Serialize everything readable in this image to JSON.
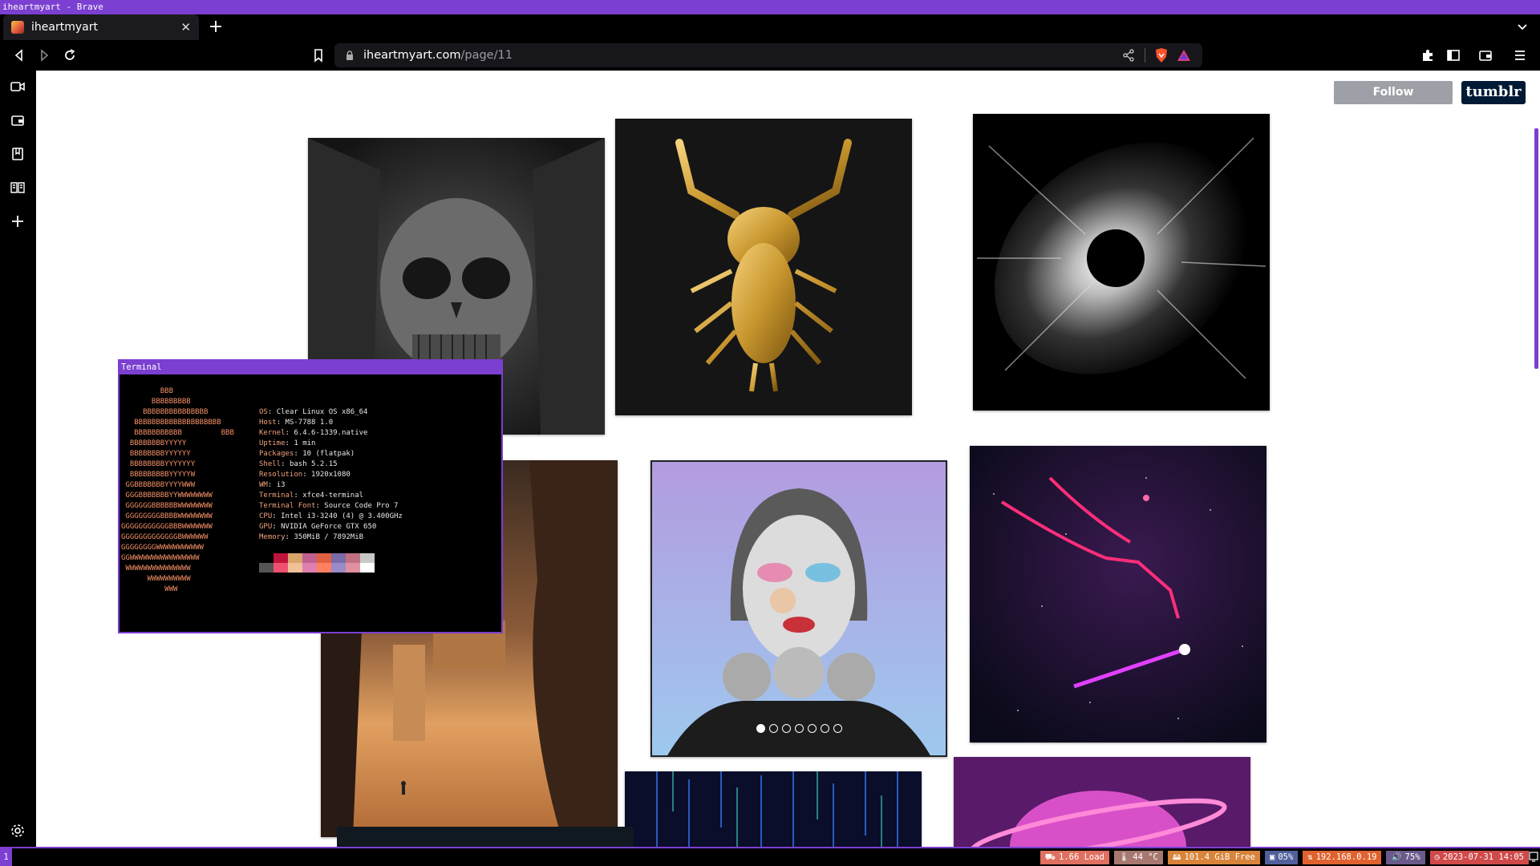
{
  "window_title": "iheartmyart - Brave",
  "tab": {
    "title": "iheartmyart"
  },
  "address": {
    "host": "iheartmyart.com",
    "path": "/page/11"
  },
  "page": {
    "follow_label": "Follow iheartmyart",
    "tumblr_logo": "tumblr",
    "carousel": {
      "total": 7,
      "active": 1
    }
  },
  "terminal": {
    "title": "Terminal",
    "ascii_logo": "         BBB\n       BBBBBBBBB\n     BBBBBBBBBBBBBBB\n   BBBBBBBBBBBBBBBBBBBB\n   BBBBBBBBBBB         BBB\n  BBBBBBBBYYYYY\n  BBBBBBBBYYYYYY\n  BBBBBBBBYYYYYYY\n  BBBBBBBBBYYYYYW\n GGBBBBBBBYYYYWWW\n GGGBBBBBBBYYWWWWWWWW\n GGGGGGBBBBBBWWWWWWWW\n GGGGGGGGBBBBWWWWWWWW\nGGGGGGGGGGGBBBWWWWWWW\nGGGGGGGGGGGGGBWWWWWW\nGGGGGGGGWWWWWWWWWWW\nGGWWWWWWWWWWWWWWWW\n WWWWWWWWWWWWWWW\n      WWWWWWWWWW\n          WWW",
    "info": [
      {
        "key": "OS",
        "value": "Clear Linux OS x86_64"
      },
      {
        "key": "Host",
        "value": "MS-7788 1.0"
      },
      {
        "key": "Kernel",
        "value": "6.4.6-1339.native"
      },
      {
        "key": "Uptime",
        "value": "1 min"
      },
      {
        "key": "Packages",
        "value": "10 (flatpak)"
      },
      {
        "key": "Shell",
        "value": "bash 5.2.15"
      },
      {
        "key": "Resolution",
        "value": "1920x1080"
      },
      {
        "key": "WM",
        "value": "i3"
      },
      {
        "key": "Terminal",
        "value": "xfce4-terminal"
      },
      {
        "key": "Terminal Font",
        "value": "Source Code Pro 7"
      },
      {
        "key": "CPU",
        "value": "Intel i3-3240 (4) @ 3.400GHz"
      },
      {
        "key": "GPU",
        "value": "NVIDIA GeForce GTX 650"
      },
      {
        "key": "Memory",
        "value": "350MiB / 7892MiB"
      }
    ],
    "palette": [
      "#000000",
      "#c0143c",
      "#d9a46a",
      "#c06090",
      "#e06040",
      "#7a6aa8",
      "#c07080",
      "#c8c8c8",
      "#555555",
      "#f05070",
      "#f0c098",
      "#e080b0",
      "#ff8060",
      "#9a8ac8",
      "#e090a0",
      "#ffffff"
    ]
  },
  "i3bar": {
    "workspace": "1",
    "blocks": [
      {
        "icon": "load-icon",
        "text": "1.66 Load",
        "color": "#e07060"
      },
      {
        "icon": "thermometer-icon",
        "text": "44 °C",
        "color": "#a87870"
      },
      {
        "icon": "disk-icon",
        "text": "101.4 GiB Free",
        "color": "#d8843a"
      },
      {
        "icon": "cpu-icon",
        "text": "05%",
        "color": "#50609a"
      },
      {
        "icon": "network-icon",
        "text": "192.168.0.19",
        "color": "#e0622e"
      },
      {
        "icon": "volume-icon",
        "text": "75%",
        "color": "#6a5a8a"
      },
      {
        "icon": "clock-icon",
        "text": "2023-07-31 14:05",
        "color": "#d04a4a"
      }
    ]
  },
  "colors": {
    "accent": "#7b3fd1"
  }
}
